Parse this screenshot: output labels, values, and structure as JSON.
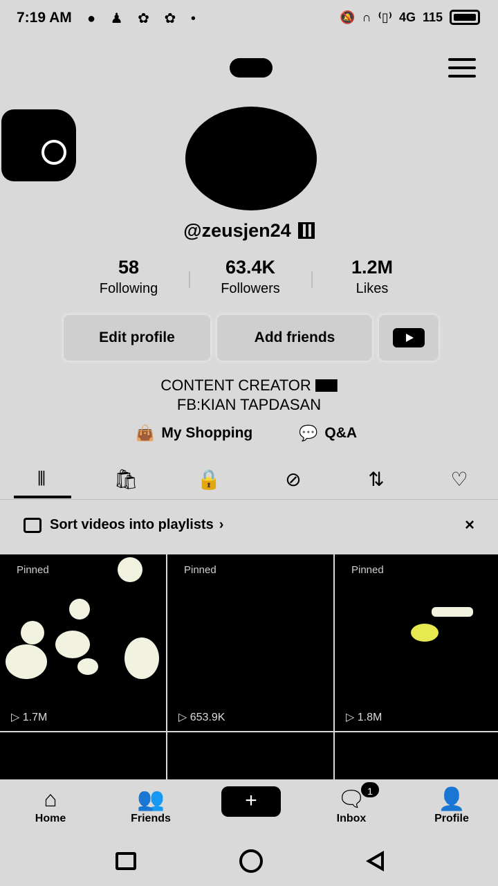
{
  "status_bar": {
    "time": "7:19 AM",
    "left_icons": [
      "messenger-icon",
      "contact-icon",
      "sync-icon",
      "sync-icon",
      "dot-icon"
    ],
    "right_icons": [
      "mute-icon",
      "headphones-icon",
      "vibrate-icon"
    ],
    "network": "4G",
    "speed": "115",
    "battery": "battery-full-icon"
  },
  "profile": {
    "username": "@zeusjen24",
    "stats": [
      {
        "value": "58",
        "label": "Following"
      },
      {
        "value": "63.4K",
        "label": "Followers"
      },
      {
        "value": "1.2M",
        "label": "Likes"
      }
    ],
    "buttons": {
      "edit": "Edit profile",
      "add_friends": "Add friends"
    },
    "bio_line1": "CONTENT CREATOR",
    "bio_line2": "FB:KIAN TAPDASAN",
    "links": {
      "shopping": "My Shopping",
      "qa": "Q&A"
    }
  },
  "tabs": [
    "videos-grid-icon",
    "shop-bag-icon",
    "lock-icon",
    "tag-hidden-icon",
    "repost-icon",
    "heart-icon"
  ],
  "playlist_prompt": {
    "label": "Sort videos into playlists",
    "chevron": "›",
    "close": "×"
  },
  "videos": [
    {
      "pinned": "Pinned",
      "views": "1.7M"
    },
    {
      "pinned": "Pinned",
      "views": "653.9K"
    },
    {
      "pinned": "Pinned",
      "views": "1.8M"
    }
  ],
  "bottom_nav": {
    "home": "Home",
    "friends": "Friends",
    "create": "+",
    "inbox": "Inbox",
    "inbox_badge": "1",
    "profile": "Profile"
  },
  "colors": {
    "background": "#d9d9d9",
    "foreground": "#000000",
    "button_bg": "#cfcfcf"
  }
}
